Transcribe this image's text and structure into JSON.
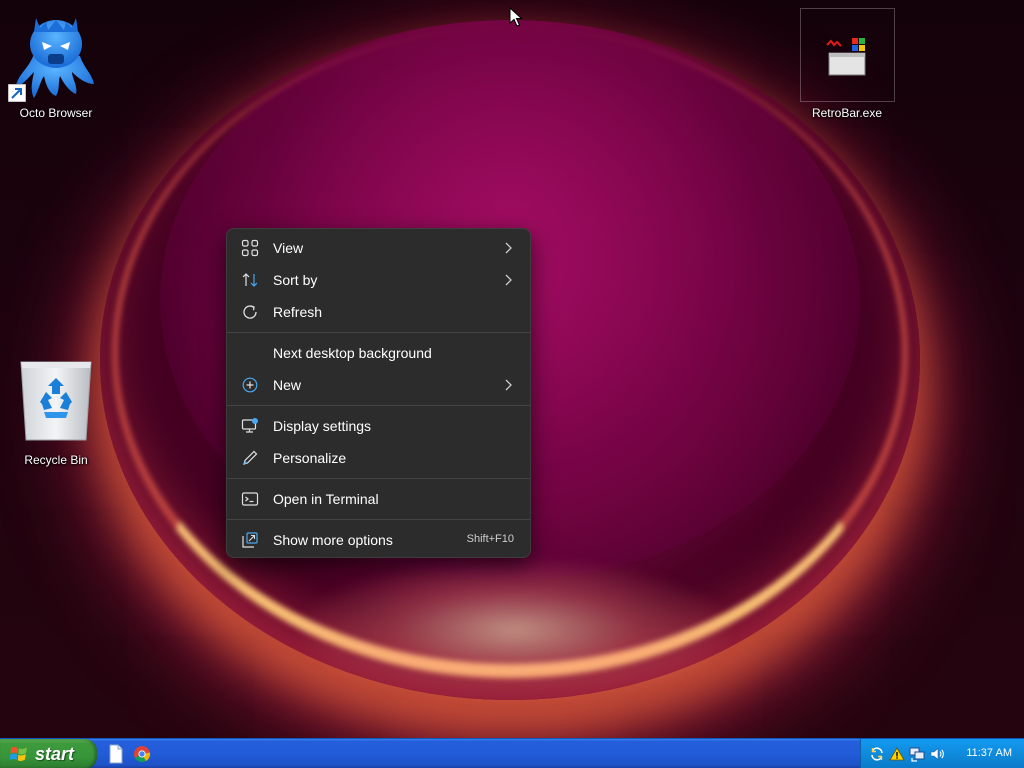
{
  "desktop": {
    "icons": [
      {
        "label": "Octo Browser",
        "icon": "octopus-icon"
      },
      {
        "label": "RetroBar.exe",
        "icon": "retrobar-icon"
      },
      {
        "label": "Recycle Bin",
        "icon": "recycle-bin-icon"
      }
    ]
  },
  "context_menu": {
    "items": [
      {
        "label": "View",
        "icon": "grid-view-icon",
        "submenu": true
      },
      {
        "label": "Sort by",
        "icon": "sort-arrows-icon",
        "submenu": true
      },
      {
        "label": "Refresh",
        "icon": "refresh-icon",
        "submenu": false
      },
      {
        "label": "Next desktop background",
        "icon": "",
        "submenu": false
      },
      {
        "label": "New",
        "icon": "plus-circle-icon",
        "submenu": true
      },
      {
        "label": "Display settings",
        "icon": "display-settings-icon",
        "submenu": false
      },
      {
        "label": "Personalize",
        "icon": "pen-icon",
        "submenu": false
      },
      {
        "label": "Open in Terminal",
        "icon": "terminal-icon",
        "submenu": false
      },
      {
        "label": "Show more options",
        "icon": "more-options-icon",
        "submenu": false,
        "accelerator": "Shift+F10"
      }
    ]
  },
  "taskbar": {
    "start_label": "start",
    "quick_launch": [
      "document-icon",
      "chrome-icon"
    ],
    "tray_icons": [
      "sync-icon",
      "warning-icon",
      "network-icon",
      "volume-icon"
    ],
    "clock": "11:37 AM"
  },
  "colors": {
    "menu_bg": "#2c2c2c",
    "taskbar_blue": "#245edb",
    "start_green": "#3d9a3c",
    "tray_blue": "#0f8bdc"
  }
}
